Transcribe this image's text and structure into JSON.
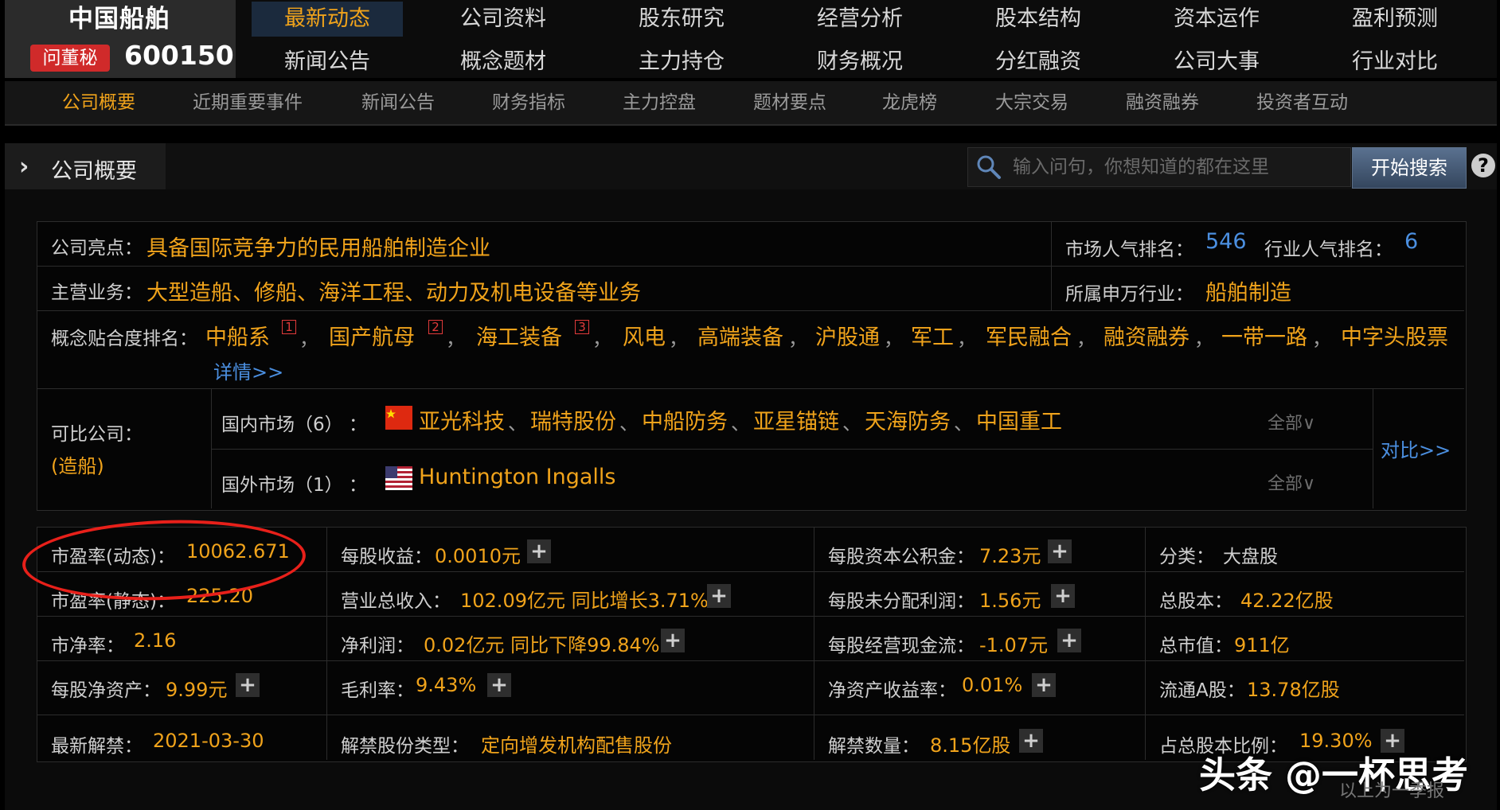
{
  "header": {
    "stock_name": "中国船舶",
    "badge": "问董秘",
    "stock_code": "600150",
    "nav_row1": [
      "最新动态",
      "公司资料",
      "股东研究",
      "经营分析",
      "股本结构",
      "资本运作",
      "盈利预测"
    ],
    "nav_row2": [
      "新闻公告",
      "概念题材",
      "主力持仓",
      "财务概况",
      "分红融资",
      "公司大事",
      "行业对比"
    ]
  },
  "subnav": [
    "公司概要",
    "近期重要事件",
    "新闻公告",
    "财务指标",
    "主力控盘",
    "题材要点",
    "龙虎榜",
    "大宗交易",
    "融资融券",
    "投资者互动"
  ],
  "section": {
    "title": "公司概要",
    "search_placeholder": "输入问句，你想知道的都在这里",
    "search_button": "开始搜索",
    "help": "?"
  },
  "overview": {
    "highlight_label": "公司亮点：",
    "highlight": "具备国际竞争力的民用船舶制造企业",
    "business_label": "主营业务：",
    "business": "大型造船、修船、海洋工程、动力及机电设备等业务",
    "market_rank_label": "市场人气排名：",
    "market_rank": "546",
    "industry_rank_label": "行业人气排名：",
    "industry_rank": "6",
    "industry_label": "所属申万行业：",
    "industry": "船舶制造",
    "concept_label": "概念贴合度排名：",
    "concepts": [
      "中船系",
      "国产航母",
      "海工装备",
      "风电",
      "高端装备",
      "沪股通",
      "军工",
      "军民融合",
      "融资融券",
      "一带一路",
      "中字头股票"
    ],
    "concept_ranks": [
      "1",
      "2",
      "3"
    ],
    "concept_sep": "，",
    "details_link": "详情>>"
  },
  "comparables": {
    "label": "可比公司：",
    "sub_label": "(造船)",
    "domestic_label": "国内市场（6）  ：",
    "domestic": [
      "亚光科技",
      "瑞特股份",
      "中船防务",
      "亚星锚链",
      "天海防务",
      "中国重工"
    ],
    "domestic_sep": "、",
    "foreign_label": "国外市场（1）  ：",
    "foreign": "Huntington Ingalls",
    "all_label": "全部∨",
    "compare_link": "对比>>"
  },
  "metrics": {
    "pe_dynamic_label": "市盈率(动态)：",
    "pe_dynamic": "10062.671",
    "pe_static_label": "市盈率(静态)：",
    "pe_static": "225.20",
    "pb_label": "市净率：",
    "pb": "2.16",
    "bvps_label": "每股净资产：",
    "bvps": "9.99元",
    "eps_label": "每股收益：",
    "eps": "0.0010元",
    "revenue_label": "营业总收入：",
    "revenue": "102.09亿元 同比增长3.71%",
    "net_profit_label": "净利润：",
    "net_profit": "0.02亿元 同比下降99.84%",
    "gross_margin_label": "毛利率：",
    "gross_margin": "9.43%",
    "capital_reserve_label": "每股资本公积金：",
    "capital_reserve": "7.23元",
    "undistributed_label": "每股未分配利润：",
    "undistributed": "1.56元",
    "op_cashflow_label": "每股经营现金流：",
    "op_cashflow": "-1.07元",
    "roe_label": "净资产收益率：",
    "roe": "0.01%",
    "class_label": "分类：",
    "class": "大盘股",
    "total_shares_label": "总股本：",
    "total_shares": "42.22亿股",
    "market_cap_label": "总市值：",
    "market_cap": "911亿",
    "float_shares_label": "流通A股：",
    "float_shares": "13.78亿股"
  },
  "unlock": {
    "date_label": "最新解禁：",
    "date": "2021-03-30",
    "type_label": "解禁股份类型：",
    "type": "定向增发机构配售股份",
    "qty_label": "解禁数量：",
    "qty": "8.15亿股",
    "ratio_label": "占总股本比例：",
    "ratio": "19.30%"
  },
  "overlay": {
    "watermark": "头条 @一杯思考",
    "footnote": "以上为一季报"
  },
  "colors": {
    "accent": "#f0a31b",
    "link": "#4b8fe0",
    "rank": "#e03a3a",
    "annotation": "#e8201a"
  }
}
